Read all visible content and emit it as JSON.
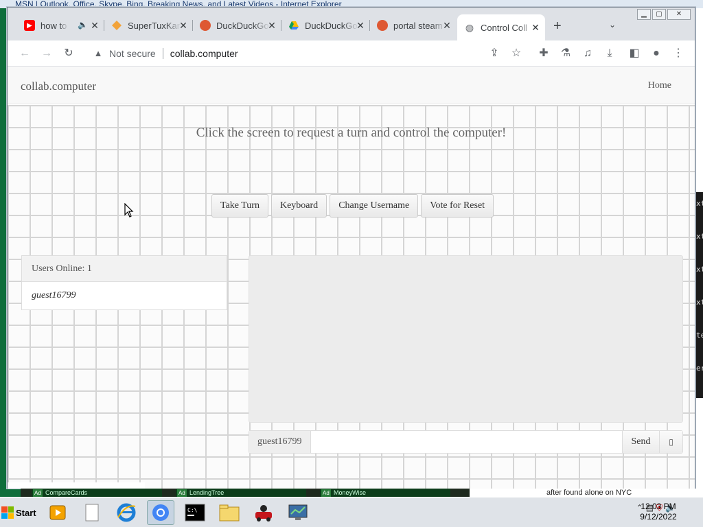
{
  "background_window": {
    "title": "MSN | Outlook, Office, Skype, Bing, Breaking News, and Latest Videos - Internet Explorer",
    "side_fragments": [
      "xt",
      "xt",
      "xt",
      "xt",
      "te",
      "er"
    ]
  },
  "browser": {
    "tabs": [
      {
        "title": "how to",
        "icon": "youtube-icon",
        "color": "#ff0000",
        "audio": true
      },
      {
        "title": "SuperTuxKart",
        "icon": "supertuxkart-icon",
        "color": "#f2a33a"
      },
      {
        "title": "DuckDuckGo",
        "icon": "duckduckgo-icon",
        "color": "#de5833"
      },
      {
        "title": "DuckDuckGo",
        "icon": "google-drive-icon",
        "color": "#4285f4"
      },
      {
        "title": "portal steam",
        "icon": "duckduckgo-icon",
        "color": "#de5833"
      },
      {
        "title": "Control Coll",
        "icon": "globe-icon",
        "color": "#5f6368",
        "active": true
      }
    ],
    "new_tab_symbol": "+",
    "tab_menu_symbol": "⌄",
    "window_buttons": [
      "▁",
      "▢",
      "✕"
    ],
    "address": {
      "security_label": "Not secure",
      "url": "collab.computer"
    }
  },
  "page": {
    "brand": "collab.computer",
    "nav_home": "Home",
    "headline": "Click the screen to request a turn and control the computer!",
    "buttons": {
      "take_turn": "Take Turn",
      "keyboard": "Keyboard",
      "change_username": "Change Username",
      "vote_reset": "Vote for Reset"
    },
    "users_panel": {
      "heading": "Users Online: 1",
      "users": [
        "guest16799"
      ]
    },
    "chat": {
      "username": "guest16799",
      "input_value": "",
      "send_label": "Send",
      "options_symbol": "▯"
    }
  },
  "taskbar": {
    "ads": [
      {
        "tag": "Ad",
        "text": "CompareCards"
      },
      {
        "tag": "Ad",
        "text": "LendingTree"
      },
      {
        "tag": "Ad",
        "text": "MoneyWise"
      }
    ],
    "news_snippet": "after found alone on NYC",
    "start_label": "Start",
    "clock_time": "12:03 PM",
    "clock_date": "9/12/2022"
  },
  "colors": {
    "chrome_tabstrip": "#dee1e6",
    "page_text": "#666666",
    "desktop_green": "#0f6e3c"
  }
}
